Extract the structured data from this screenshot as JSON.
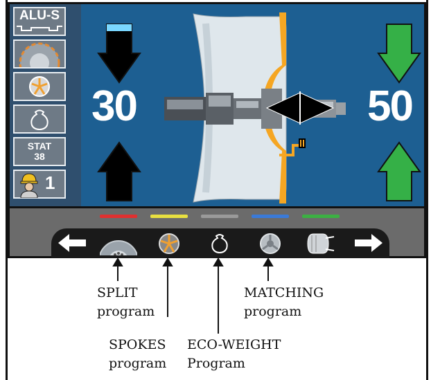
{
  "side_panel": {
    "alu_label": "ALU-S",
    "stat_label": "STAT",
    "stat_value": "38",
    "operator_number": "1"
  },
  "left_value": "30",
  "right_value": "50",
  "toolbar": {
    "indicator_colors": [
      "#e03030",
      "#e8e040",
      "#9a9a9a",
      "#3a7ad8",
      "#3cb043"
    ]
  },
  "captions": {
    "split": "SPLIT program",
    "spokes": "SPOKES program",
    "eco_weight": "ECO-WEIGHT Program",
    "matching": "MATCHING program"
  }
}
